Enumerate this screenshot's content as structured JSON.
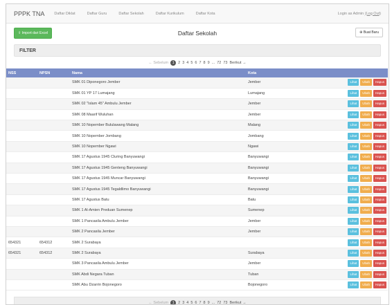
{
  "navbar": {
    "brand": "PPPK TNA",
    "links": [
      "Daftar Diklat",
      "Daftar Guru",
      "Daftar Sekolah",
      "Daftar Kurikulum",
      "Daftar Kota"
    ],
    "login_text": "Login as Admin",
    "logout_label": "(Log Out)"
  },
  "toolbar": {
    "import_label": "Import dari Excel",
    "title": "Daftar Sekolah",
    "new_label": "Buat Baru"
  },
  "filter_label": "FILTER",
  "pagination": {
    "prev": "← Sebelum",
    "active": "1",
    "pages": [
      "2",
      "3",
      "4",
      "5",
      "6",
      "7",
      "8",
      "9"
    ],
    "ellipsis": "...",
    "tail": [
      "72",
      "73"
    ],
    "next": "Berikut →"
  },
  "table": {
    "headers": [
      "NSS",
      "NPSN",
      "Nama",
      "Kota"
    ],
    "rows": [
      {
        "nss": "",
        "npsn": "",
        "nama": "SMK 01 Diponegoro Jember",
        "kota": "Jember"
      },
      {
        "nss": "",
        "npsn": "",
        "nama": "SMK 01 YP 17 Lumajang",
        "kota": "Lumajang"
      },
      {
        "nss": "",
        "npsn": "",
        "nama": "SMK 02 \"Islam 45\" Ambulu Jember",
        "kota": "Jember"
      },
      {
        "nss": "",
        "npsn": "",
        "nama": "SMK 08 Maarif Wuluhan",
        "kota": "Jember"
      },
      {
        "nss": "",
        "npsn": "",
        "nama": "SMK 10 Nopember Bululawang Malang",
        "kota": "Malang"
      },
      {
        "nss": "",
        "npsn": "",
        "nama": "SMK 10 Nopember Jombang",
        "kota": "Jombang"
      },
      {
        "nss": "",
        "npsn": "",
        "nama": "SMK 10 Nopember Ngawi",
        "kota": "Ngawi"
      },
      {
        "nss": "",
        "npsn": "",
        "nama": "SMK 17 Agustus 1945 Cluring Banyuwangi",
        "kota": "Banyuwangi"
      },
      {
        "nss": "",
        "npsn": "",
        "nama": "SMK 17 Agustus 1945 Genteng Banyuwangi",
        "kota": "Banyuwangi"
      },
      {
        "nss": "",
        "npsn": "",
        "nama": "SMK 17 Agustus 1945 Muncar Banyuwangi",
        "kota": "Banyuwangi"
      },
      {
        "nss": "",
        "npsn": "",
        "nama": "SMK 17 Agustus 1945 Tegaldlimo Banyuwangi",
        "kota": "Banyuwangi"
      },
      {
        "nss": "",
        "npsn": "",
        "nama": "SMK 17 Agustus Batu",
        "kota": "Batu"
      },
      {
        "nss": "",
        "npsn": "",
        "nama": "SMK 1 Al-Amien Preduan Sumenep",
        "kota": "Sumenep"
      },
      {
        "nss": "",
        "npsn": "",
        "nama": "SMK 1 Pancasila Ambulu Jember",
        "kota": "Jember"
      },
      {
        "nss": "",
        "npsn": "",
        "nama": "SMK 2 Pancasila Jember",
        "kota": "Jember"
      },
      {
        "nss": "654321",
        "npsn": "654312",
        "nama": "SMK 2 Surabaya",
        "kota": ""
      },
      {
        "nss": "654321",
        "npsn": "654312",
        "nama": "SMK 2 Surabaya",
        "kota": "Surabaya"
      },
      {
        "nss": "",
        "npsn": "",
        "nama": "SMK 3 Pancasila Ambulu Jember",
        "kota": "Jember"
      },
      {
        "nss": "",
        "npsn": "",
        "nama": "SMK Abdi Negara Tuban",
        "kota": "Tuban"
      },
      {
        "nss": "",
        "npsn": "",
        "nama": "SMK Abu Dzarrin Bojonegoro",
        "kota": "Bojonegoro"
      }
    ],
    "actions": {
      "view": "Lihat",
      "edit": "Ubah",
      "delete": "Hapus"
    }
  }
}
